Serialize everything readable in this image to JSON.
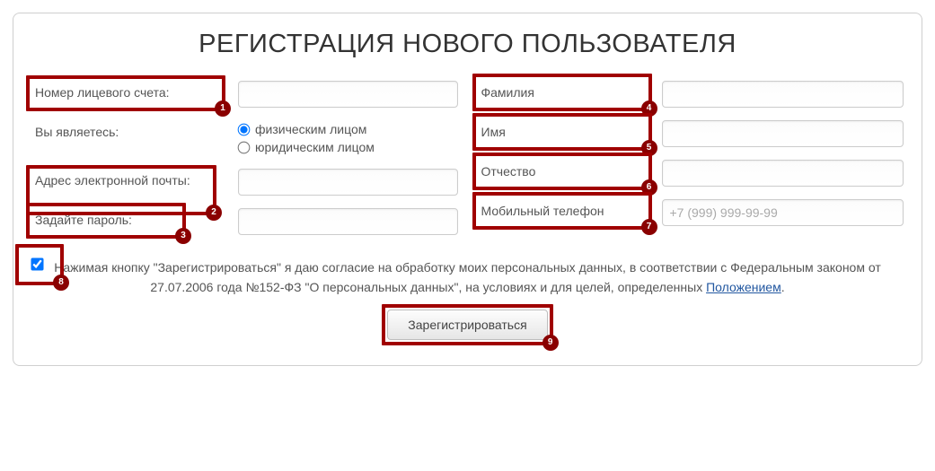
{
  "title": "РЕГИСТРАЦИЯ НОВОГО ПОЛЬЗОВАТЕЛЯ",
  "left": {
    "account_label": "Номер лицевого счета:",
    "you_are_label": "Вы являетесь:",
    "radio_individual": "физическим лицом",
    "radio_legal": "юридическим лицом",
    "email_label": "Адрес электронной почты:",
    "password_label": "Задайте пароль:"
  },
  "right": {
    "surname_label": "Фамилия",
    "name_label": "Имя",
    "patronymic_label": "Отчество",
    "phone_label": "Мобильный телефон",
    "phone_placeholder": "+7 (999) 999-99-99"
  },
  "consent": {
    "part1": "Нажимая кнопку \"Зарегистрироваться\" я даю согласие на обработку моих персональных данных, в соответствии с Федеральным законом от 27.07.2006 года №152-ФЗ \"О персональных данных\", на условиях и для целей, определенных ",
    "link": "Положением",
    "dot": "."
  },
  "submit_label": "Зарегистрироваться",
  "badges": {
    "b1": "1",
    "b2": "2",
    "b3": "3",
    "b4": "4",
    "b5": "5",
    "b6": "6",
    "b7": "7",
    "b8": "8",
    "b9": "9"
  }
}
